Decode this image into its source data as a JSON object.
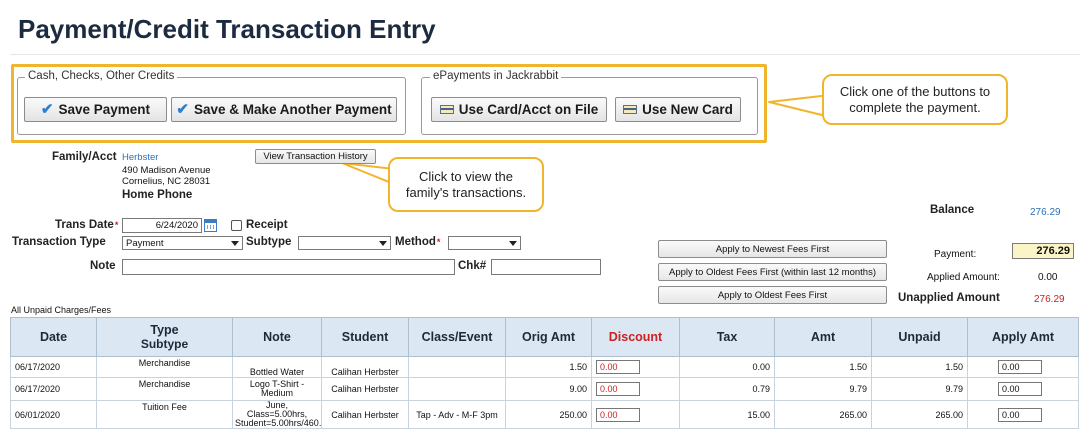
{
  "page": {
    "title": "Payment/Credit Transaction Entry"
  },
  "cash_group": {
    "legend": "Cash, Checks, Other Credits",
    "save_payment": "Save Payment",
    "save_another": "Save & Make Another Payment"
  },
  "epay_group": {
    "legend": "ePayments in Jackrabbit",
    "use_card_file": "Use Card/Acct on File",
    "use_new_card": "Use New Card"
  },
  "callouts": {
    "buttons": "Click one of the buttons to complete the payment.",
    "history": "Click to view the family's transactions."
  },
  "family": {
    "label": "Family/Acct",
    "name": "Herbster",
    "address1": "490 Madison Avenue",
    "address2": "Cornelius, NC  28031",
    "phone_label": "Home Phone",
    "history_button": "View Transaction History"
  },
  "form": {
    "trans_date_label": "Trans Date",
    "trans_date": "6/24/2020",
    "receipt_label": "Receipt",
    "type_label": "Transaction Type",
    "type_value": "Payment",
    "subtype_label": "Subtype",
    "subtype_value": "",
    "method_label": "Method",
    "method_value": "",
    "note_label": "Note",
    "note_value": "",
    "chk_label": "Chk#",
    "chk_value": "",
    "required_mark": "*"
  },
  "apply_buttons": {
    "newest": "Apply to Newest Fees First",
    "oldest_12": "Apply to Oldest Fees First (within last 12 months)",
    "oldest": "Apply to Oldest Fees First"
  },
  "summary": {
    "balance_label": "Balance",
    "balance_value": "276.29",
    "payment_label": "Payment:",
    "payment_value": "276.29",
    "applied_label": "Applied Amount:",
    "applied_value": "0.00",
    "unapplied_label": "Unapplied Amount",
    "unapplied_value": "276.29"
  },
  "table": {
    "caption": "All Unpaid Charges/Fees",
    "headers": {
      "date": "Date",
      "type": "Type",
      "subtype": "Subtype",
      "note": "Note",
      "student": "Student",
      "class": "Class/Event",
      "orig": "Orig Amt",
      "discount": "Discount",
      "tax": "Tax",
      "amt": "Amt",
      "unpaid": "Unpaid",
      "apply": "Apply Amt"
    },
    "rows": [
      {
        "date": "06/17/2020",
        "type": "Merchandise",
        "note": "Bottled Water",
        "student": "Calihan Herbster",
        "class": "",
        "orig": "1.50",
        "discount": "0.00",
        "tax": "0.00",
        "amt": "1.50",
        "unpaid": "1.50",
        "apply": "0.00"
      },
      {
        "date": "06/17/2020",
        "type": "Merchandise",
        "note": "Logo T-Shirt - Medium",
        "student": "Calihan Herbster",
        "class": "",
        "orig": "9.00",
        "discount": "0.00",
        "tax": "0.79",
        "amt": "9.79",
        "unpaid": "9.79",
        "apply": "0.00"
      },
      {
        "date": "06/01/2020",
        "type": "Tuition Fee",
        "note": "June, Class=5.00hrs, Student=5.00hrs/460.",
        "student": "Calihan Herbster",
        "class": "Tap - Adv - M-F 3pm",
        "orig": "250.00",
        "discount": "0.00",
        "tax": "15.00",
        "amt": "265.00",
        "unpaid": "265.00",
        "apply": "0.00"
      }
    ]
  },
  "colors": {
    "highlight": "#f1b52d",
    "header_bg": "#dbe7f3",
    "link": "#2f6fb5",
    "discount_red": "#c22222",
    "payment_bg": "#fbf4c6"
  },
  "icons": [
    "check-icon",
    "credit-card-icon",
    "calendar-icon",
    "chevron-down-icon"
  ]
}
